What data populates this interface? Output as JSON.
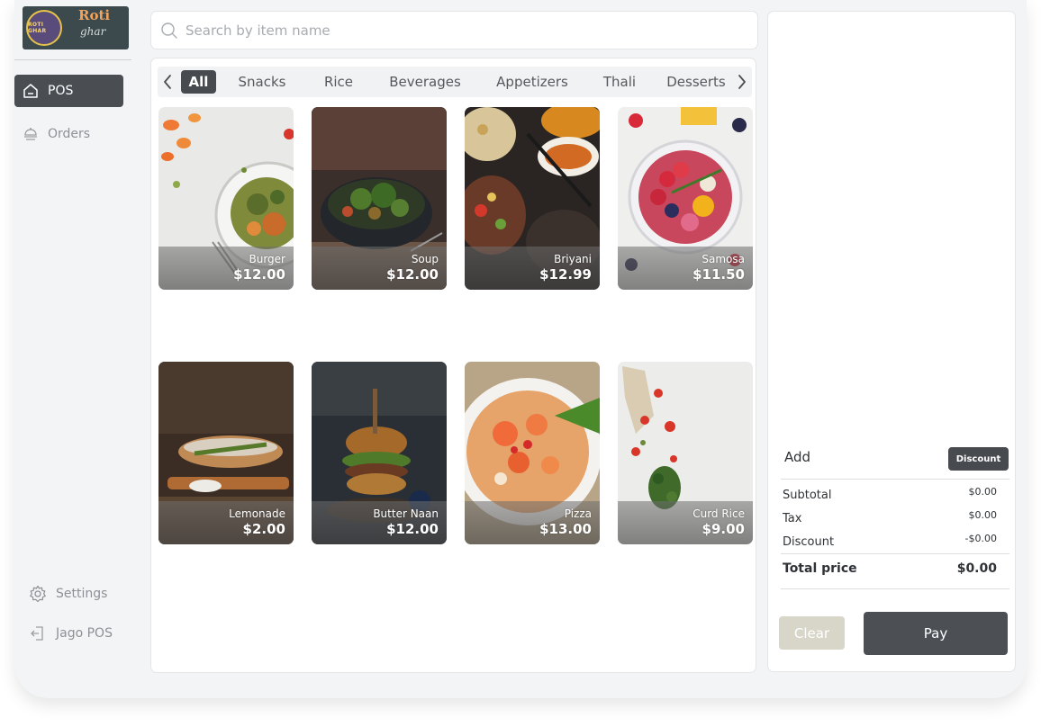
{
  "brand": {
    "logo_text_1": "Roti",
    "logo_text_2": "ghar",
    "emblem_text": "ROTI GHAR"
  },
  "sidebar": {
    "items": [
      {
        "label": "POS",
        "icon": "home-icon",
        "active": true
      },
      {
        "label": "Orders",
        "icon": "orders-icon",
        "active": false
      }
    ],
    "bottom": [
      {
        "label": "Settings",
        "icon": "gear-icon"
      },
      {
        "label": "Jago POS",
        "icon": "logout-icon"
      }
    ]
  },
  "search": {
    "placeholder": "Search by item name",
    "value": ""
  },
  "categories": {
    "tabs": [
      "All",
      "Snacks",
      "Rice",
      "Beverages",
      "Appetizers",
      "Thali",
      "Desserts"
    ],
    "selected": "All"
  },
  "products": [
    {
      "name": "Burger",
      "price": "$12.00"
    },
    {
      "name": "Soup",
      "price": "$12.00"
    },
    {
      "name": "Briyani",
      "price": "$12.99"
    },
    {
      "name": "Samosa",
      "price": "$11.50"
    },
    {
      "name": "Lemonade",
      "price": "$2.00"
    },
    {
      "name": "Butter Naan",
      "price": "$12.00"
    },
    {
      "name": "Pizza",
      "price": "$13.00"
    },
    {
      "name": "Curd Rice",
      "price": "$9.00"
    }
  ],
  "order": {
    "add_label": "Add",
    "discount_button": "Discount",
    "subtotal_label": "Subtotal",
    "subtotal": "$0.00",
    "tax_label": "Tax",
    "tax": "$0.00",
    "discount_label": "Discount",
    "discount": "-$0.00",
    "total_label": "Total price",
    "total": "$0.00",
    "clear_button": "Clear",
    "pay_button": "Pay"
  },
  "colors": {
    "accent": "#474b50",
    "clear": "#d7d6c8",
    "background": "#f3f4f5"
  }
}
